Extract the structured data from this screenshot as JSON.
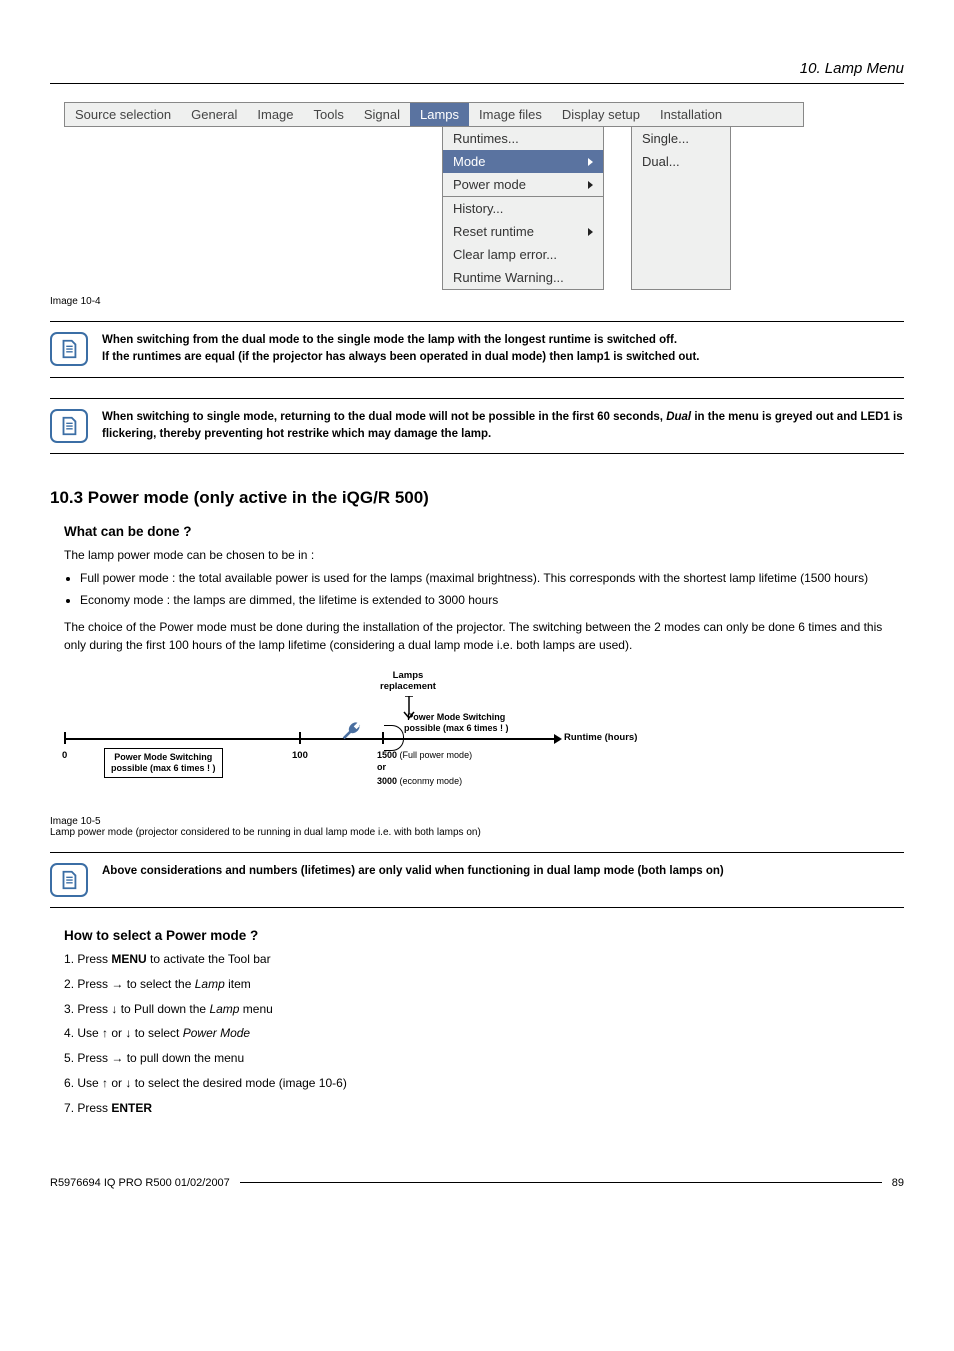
{
  "header": {
    "chapter": "10. Lamp Menu"
  },
  "menubar": {
    "items": [
      "Source selection",
      "General",
      "Image",
      "Tools",
      "Signal",
      "Lamps",
      "Image files",
      "Display setup",
      "Installation"
    ],
    "active_index": 5
  },
  "dropdown_lamps": {
    "items": [
      {
        "label": "Runtimes...",
        "arrow": false,
        "active": false
      },
      {
        "label": "Mode",
        "arrow": true,
        "active": true
      },
      {
        "label": "Power mode",
        "arrow": true,
        "active": false
      },
      {
        "label": "History...",
        "arrow": false,
        "active": false,
        "sep": true
      },
      {
        "label": "Reset runtime",
        "arrow": true,
        "active": false
      },
      {
        "label": "Clear lamp error...",
        "arrow": false,
        "active": false
      },
      {
        "label": "Runtime Warning...",
        "arrow": false,
        "active": false
      }
    ]
  },
  "dropdown_mode": {
    "items": [
      {
        "label": "Single..."
      },
      {
        "label": "Dual..."
      }
    ]
  },
  "caption_10_4": "Image 10-4",
  "note1": {
    "line1_b": "When switching from the dual mode to the single mode the lamp with the longest runtime is switched off.",
    "line2_b": "If the runtimes are equal (if the projector has always been operated in dual mode) then lamp1 is switched out."
  },
  "note2": {
    "prefix": "When switching to single mode, returning to the dual mode will not be possible in the first 60 seconds, ",
    "em": "Dual",
    "suffix": " in the menu is greyed out and LED1 is flickering, thereby preventing hot restrike which may damage the lamp."
  },
  "section_10_3": {
    "title": "10.3  Power mode (only active in the iQG/R 500)",
    "what_h": "What can be done ?",
    "intro": "The lamp power mode can be chosen to be in :",
    "bullets": [
      "Full power mode :  the total available power is used for the lamps (maximal brightness).  This corresponds with the shortest lamp lifetime (1500 hours)",
      "Economy mode :  the lamps are dimmed, the lifetime is extended to 3000 hours"
    ],
    "choice_p": "The choice of the Power mode must be done during the installation of the projector.  The switching between the 2 modes can only be done 6 times and this only during the first 100 hours of the lamp lifetime (considering a dual lamp mode i.e.  both lamps are used)."
  },
  "diagram": {
    "top_label_l1": "Lamps",
    "top_label_l2": "replacement",
    "zero": "0",
    "box_left_l1": "Power Mode Switching",
    "box_left_l2": "possible (max 6 times ! )",
    "hundred": "100",
    "box_right_l1": "Power Mode Switching",
    "box_right_l2": "possible (max 6 times ! )",
    "at1500_a": "1500",
    "at1500_b": "(Full power mode)",
    "or": "or",
    "at3000_a": "3000",
    "at3000_b": "(econmy mode)",
    "runtime": "Runtime (hours)"
  },
  "caption_10_5_a": "Image 10-5",
  "caption_10_5_b": "Lamp power mode (projector considered to be running in dual lamp mode i.e.  with both lamps on)",
  "note3": {
    "text": "Above considerations and numbers (lifetimes) are only valid when functioning in dual lamp mode (both lamps on)"
  },
  "howto": {
    "h": "How to select a Power mode ?",
    "steps": [
      {
        "pre": "Press ",
        "b": "MENU",
        "post": " to activate the Tool bar"
      },
      {
        "pre": "Press → to select the ",
        "i": "Lamp",
        "post": " item"
      },
      {
        "pre": "Press ↓ to Pull down the ",
        "i": "Lamp",
        "post": " menu"
      },
      {
        "pre": "Use ↑ or ↓ to select ",
        "i": "Power Mode",
        "post": ""
      },
      {
        "pre": "Press → to pull down the menu",
        "i": "",
        "post": ""
      },
      {
        "pre": "Use ↑ or ↓ to select the desired mode (image 10-6)",
        "i": "",
        "post": ""
      },
      {
        "pre": "Press ",
        "b": "ENTER",
        "post": ""
      }
    ]
  },
  "footer": {
    "left": "R5976694  IQ PRO R500  01/02/2007",
    "page": "89"
  }
}
